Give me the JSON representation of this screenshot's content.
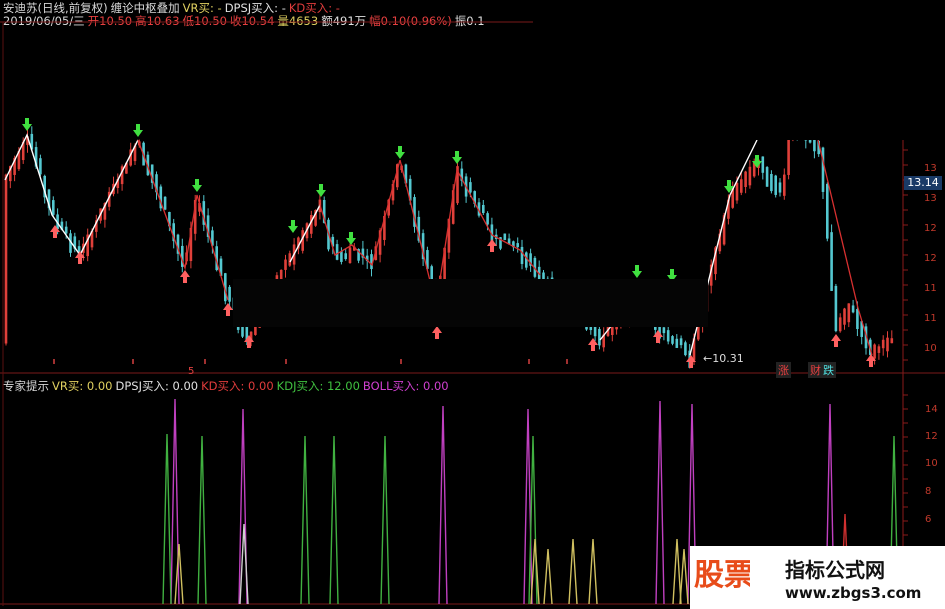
{
  "header": {
    "line1": [
      {
        "text": "安迪苏(日线,前复权)",
        "color": "#d8d8d8"
      },
      {
        "text": "缠论中枢叠加",
        "color": "#d8d8d8"
      },
      {
        "text": "VR买: -",
        "color": "#e0d060"
      },
      {
        "text": "DPSJ买入: -",
        "color": "#e0e0e0"
      },
      {
        "text": "KD买入: -",
        "color": "#e03c3c"
      }
    ],
    "line2": [
      {
        "text": "2019/06/05/三",
        "color": "#d8d8d8"
      },
      {
        "text": "开10.50",
        "color": "#e84040"
      },
      {
        "text": "高10.63",
        "color": "#e84040"
      },
      {
        "text": "低10.50",
        "color": "#e84040"
      },
      {
        "text": "收10.54",
        "color": "#e84040"
      },
      {
        "text": "量4653",
        "color": "#e0d060"
      },
      {
        "text": "额491万",
        "color": "#e0e0e0"
      },
      {
        "text": "幅0.10(0.96%)",
        "color": "#e84040"
      },
      {
        "text": "振0.1",
        "color": "#e0e0e0"
      }
    ]
  },
  "price_tag": "13.14",
  "price_axis": [
    "13",
    "13",
    "12",
    "12",
    "11",
    "11",
    "10"
  ],
  "min_price_label": "10.31",
  "tag_rise": "涨",
  "tag_fall": "跌",
  "tag_watch": "财",
  "indicator": {
    "name": "专家提示",
    "items": [
      {
        "text": "VR买: 0.00",
        "color": "#e0d060"
      },
      {
        "text": "DPSJ买入: 0.00",
        "color": "#e0e0e0"
      },
      {
        "text": "KD买入: 0.00",
        "color": "#e03c3c"
      },
      {
        "text": "KDJ买入: 12.00",
        "color": "#40c040"
      },
      {
        "text": "BOLL买入: 0.00",
        "color": "#d040d0"
      }
    ]
  },
  "sub_axis": [
    "14",
    "12",
    "10",
    "8",
    "6"
  ],
  "watermark": {
    "left": "股票",
    "right_title": "指标公式网",
    "right_url": "www.zbgs3.com"
  },
  "colors": {
    "up": "#e0403a",
    "down": "#54c8d0",
    "buy_arrow": "#ff6060",
    "sell_arrow": "#40e040",
    "zigzag_white": "#ffffff",
    "zigzag_red": "#d83030"
  }
}
